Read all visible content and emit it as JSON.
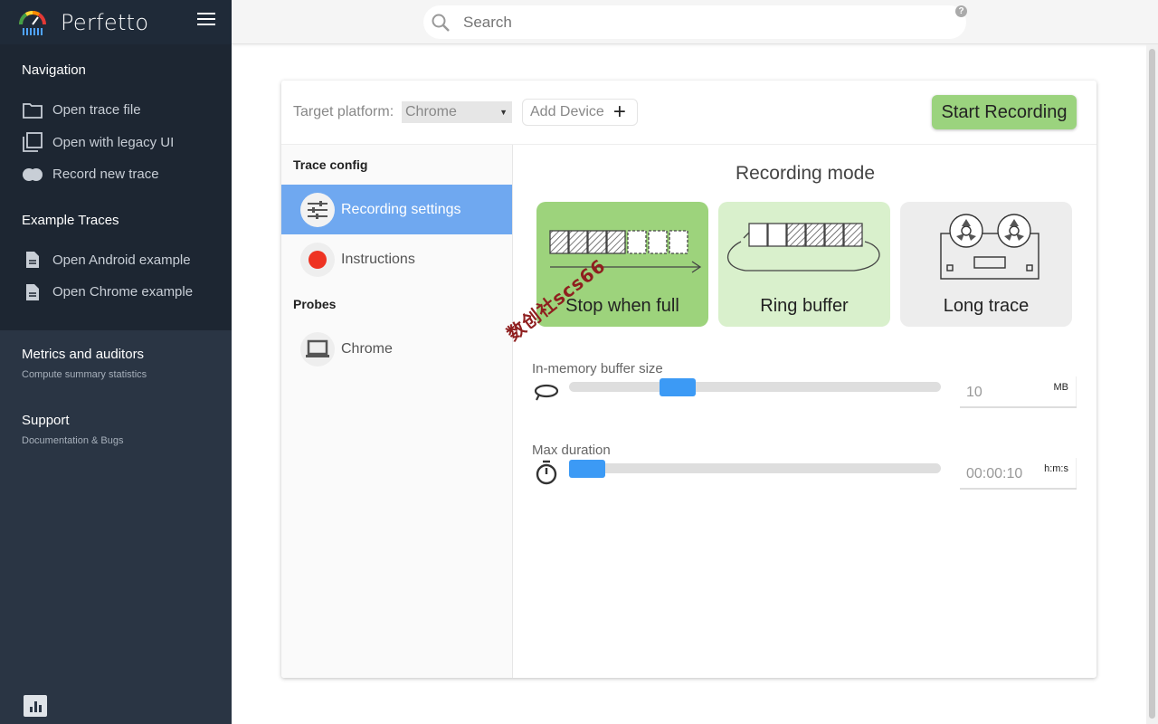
{
  "app": {
    "name": "Perfetto"
  },
  "search": {
    "placeholder": "Search",
    "help": "?"
  },
  "sidebar": {
    "navigation": {
      "title": "Navigation",
      "items": [
        {
          "label": "Open trace file",
          "icon": "folder-icon"
        },
        {
          "label": "Open with legacy UI",
          "icon": "library-icon"
        },
        {
          "label": "Record new trace",
          "icon": "record-toggle-icon"
        }
      ]
    },
    "examples": {
      "title": "Example Traces",
      "items": [
        {
          "label": "Open Android example",
          "icon": "description-icon"
        },
        {
          "label": "Open Chrome example",
          "icon": "description-icon"
        }
      ]
    },
    "metrics": {
      "title": "Metrics and auditors",
      "subtitle": "Compute summary statistics"
    },
    "support": {
      "title": "Support",
      "subtitle": "Documentation & Bugs"
    }
  },
  "record": {
    "target_label": "Target platform:",
    "target_value": "Chrome",
    "add_device": "Add Device",
    "start": "Start Recording",
    "trace_config_title": "Trace config",
    "probes_title": "Probes",
    "menu": {
      "recording_settings": "Recording settings",
      "instructions": "Instructions",
      "chrome": "Chrome"
    },
    "mode_title": "Recording mode",
    "modes": {
      "stop": "Stop when full",
      "ring": "Ring buffer",
      "long": "Long trace"
    },
    "buffer": {
      "label": "In-memory buffer size",
      "value": "10",
      "unit": "MB",
      "slider_fraction": 0.27
    },
    "duration": {
      "label": "Max duration",
      "value": "00:00:10",
      "unit": "h:m:s",
      "slider_fraction": 0.0
    },
    "watermark": "数创社scs66"
  },
  "colors": {
    "sidebar_bg": "#2a3544",
    "sidebar_header_bg": "#1f2a38",
    "active_menu": "#6fa8f0",
    "start_button": "#9bd37e",
    "slider_thumb": "#3c9af5",
    "instructions_dot": "#ee3322"
  }
}
